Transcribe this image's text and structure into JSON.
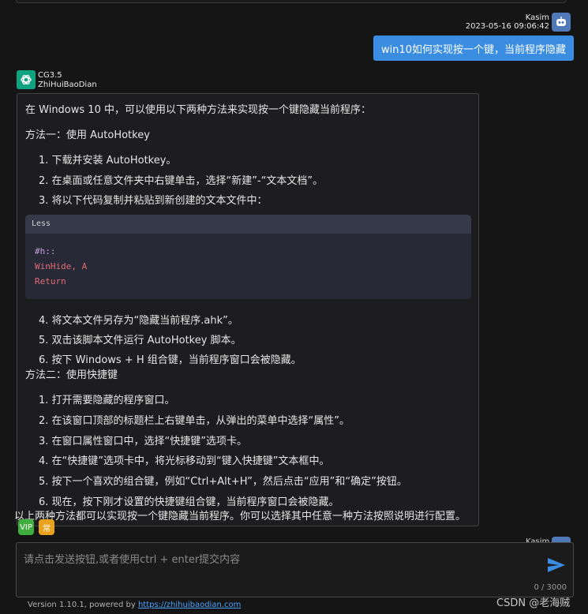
{
  "user_message": {
    "name": "Kasim",
    "timestamp": "2023-05-16 09:06:42",
    "text": "win10如何实现按一个键，当前程序隐藏"
  },
  "bot_message": {
    "model": "CG3.5",
    "source": "ZhiHuiBaoDian",
    "intro": "在 Windows 10 中，可以使用以下两种方法来实现按一个键隐藏当前程序：",
    "method1_title": "方法一：使用 AutoHotkey",
    "method1_steps": [
      "1. 下载并安装 AutoHotkey。",
      "2. 在桌面或任意文件夹中右键单击，选择“新建”-“文本文档”。",
      "3. 将以下代码复制并粘贴到新创建的文本文件中：",
      "4. 将文本文件另存为“隐藏当前程序.ahk”。",
      "5. 双击该脚本文件运行 AutoHotkey 脚本。",
      "6. 按下 Windows + H 组合键，当前程序窗口会被隐藏。"
    ],
    "code": {
      "language": "Less",
      "lines": [
        "#h::",
        "WinHide, A",
        "Return"
      ]
    },
    "method2_title": "方法二：使用快捷键",
    "method2_steps": [
      "1. 打开需要隐藏的程序窗口。",
      "2. 在该窗口顶部的标题栏上右键单击，从弹出的菜单中选择“属性”。",
      "3. 在窗口属性窗口中，选择“快捷键”选项卡。",
      "4. 在“快捷键”选项卡中，将光标移动到“键入快捷键”文本框中。",
      "5. 按下一个喜欢的组合键，例如“Ctrl+Alt+H”，然后点击“应用”和“确定”按钮。",
      "6. 现在，按下刚才设置的快捷键组合键，当前程序窗口会被隐藏。"
    ],
    "conclusion": "以上两种方法都可以实现按一个键隐藏当前程序。你可以选择其中任意一种方法按照说明进行配置。"
  },
  "badges": {
    "vip": "VIP",
    "chang": "常"
  },
  "peek_name": "Kasim",
  "input": {
    "placeholder": "请点击发送按钮,或者使用ctrl + enter提交内容",
    "char_count": "0 / 3000"
  },
  "footer": {
    "text": "Version 1.10.1, powered by ",
    "link": "https://zhihuibaodian.com"
  },
  "watermark": "CSDN @老海贼",
  "colors": {
    "user_bubble": "#3a8de0",
    "bot_avatar": "#10a37f",
    "code_keyword": "#e06c75",
    "code_selector": "#c5a0d8",
    "send_icon": "#3a8de0"
  }
}
